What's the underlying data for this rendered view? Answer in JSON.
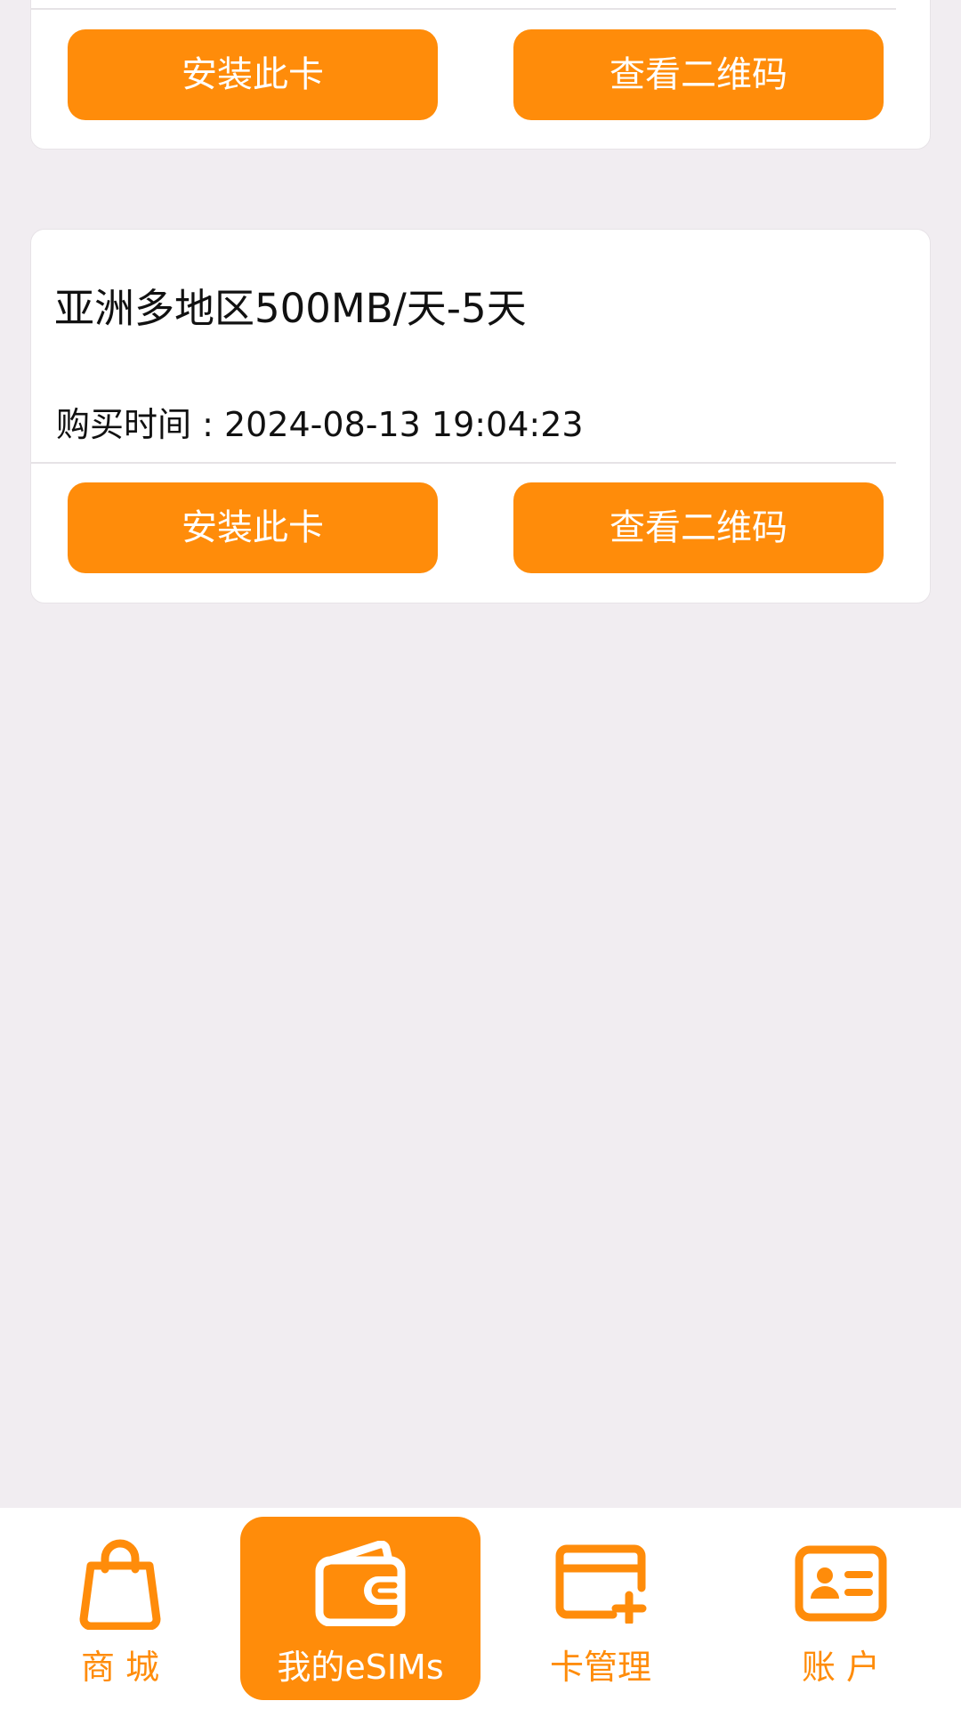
{
  "colors": {
    "accent": "#ff8c0a",
    "background": "#f1edf1",
    "card": "#ffffff",
    "text": "#111111"
  },
  "cards": [
    {
      "install_label": "安装此卡",
      "qr_label": "查看二维码"
    },
    {
      "title": "亚洲多地区500MB/天-5天",
      "purchase_time_label": "购买时间 : ",
      "purchase_time": "2024-08-13 19:04:23",
      "install_label": "安装此卡",
      "qr_label": "查看二维码"
    }
  ],
  "nav": {
    "items": [
      {
        "label": "商 城",
        "icon": "shopping-bag-icon",
        "active": false
      },
      {
        "label": "我的eSIMs",
        "icon": "wallet-icon",
        "active": true
      },
      {
        "label": "卡管理",
        "icon": "card-add-icon",
        "active": false
      },
      {
        "label": "账 户",
        "icon": "id-card-icon",
        "active": false
      }
    ]
  }
}
